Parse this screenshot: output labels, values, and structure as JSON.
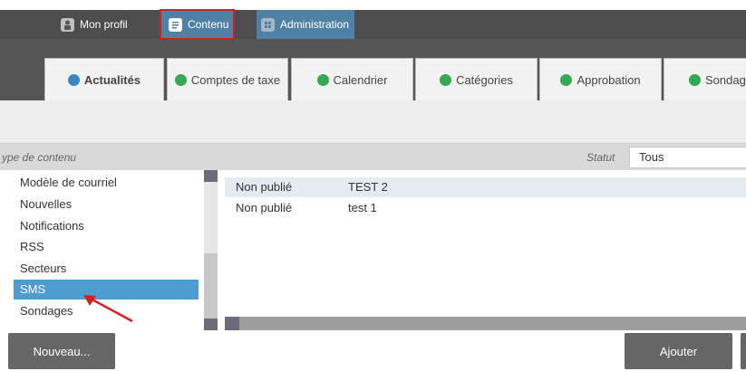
{
  "topnav": {
    "profil": {
      "label": "Mon profil",
      "icon": "user-icon"
    },
    "contenu": {
      "label": "Contenu",
      "icon": "document-icon"
    },
    "administration": {
      "label": "Administration",
      "icon": "admin-icon"
    }
  },
  "tabs": [
    {
      "label": "Actualités",
      "icon": "home-icon",
      "icon_color": "#3a87c8"
    },
    {
      "label": "Comptes de taxe",
      "icon": "leaf-icon",
      "icon_color": "#34a853"
    },
    {
      "label": "Calendrier",
      "icon": "leaf-icon",
      "icon_color": "#34a853"
    },
    {
      "label": "Catégories",
      "icon": "leaf-icon",
      "icon_color": "#34a853"
    },
    {
      "label": "Approbation",
      "icon": "leaf-icon",
      "icon_color": "#34a853"
    },
    {
      "label": "Sondag",
      "icon": "leaf-icon",
      "icon_color": "#34a853"
    }
  ],
  "filter": {
    "type_label": "ype de contenu",
    "statut_label": "Statut",
    "statut_value": "Tous"
  },
  "content_types": [
    {
      "label": "Modèle de courriel",
      "selected": false
    },
    {
      "label": "Nouvelles",
      "selected": false
    },
    {
      "label": "Notifications",
      "selected": false
    },
    {
      "label": "RSS",
      "selected": false
    },
    {
      "label": "Secteurs",
      "selected": false
    },
    {
      "label": "SMS",
      "selected": true
    },
    {
      "label": "Sondages",
      "selected": false
    }
  ],
  "content_rows": [
    {
      "status": "Non publié",
      "name": "TEST 2"
    },
    {
      "status": "Non publié",
      "name": "test 1"
    }
  ],
  "buttons": {
    "nouveau": "Nouveau...",
    "ajouter": "Ajouter"
  },
  "colors": {
    "accent_blue": "#4f81a6",
    "selection_blue": "#4f9cd0",
    "highlight_red": "#d62020"
  }
}
